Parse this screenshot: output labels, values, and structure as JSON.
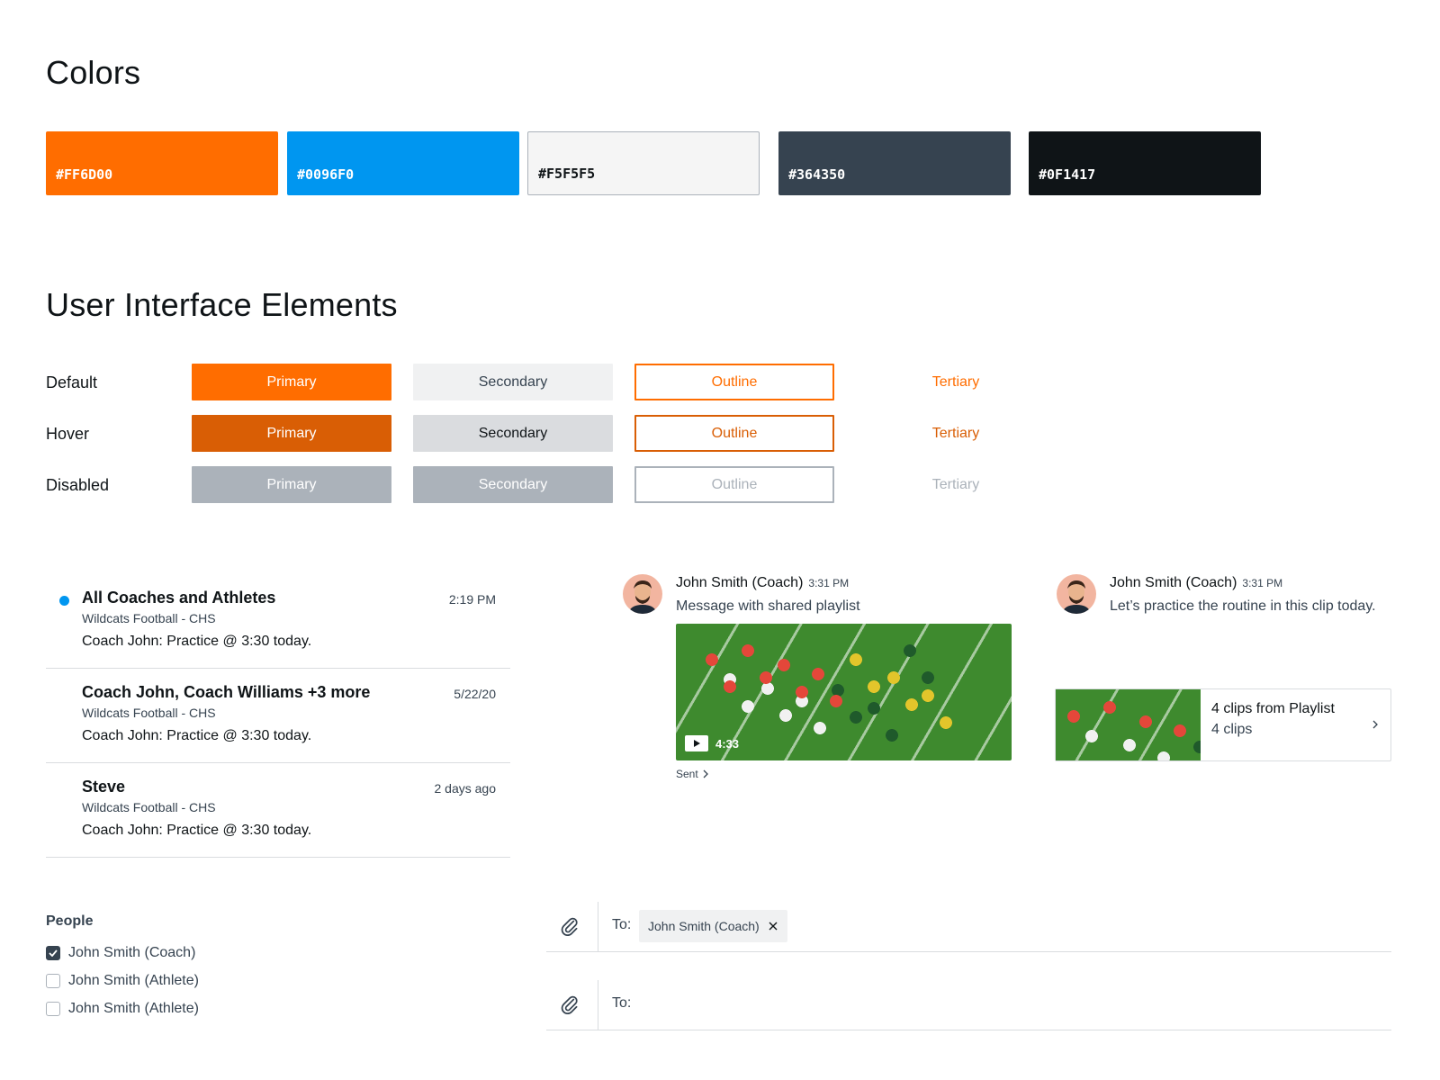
{
  "colors_section": {
    "title": "Colors",
    "swatches": [
      {
        "hex": "#FF6D00",
        "label": "#FF6D00",
        "text_color": "#FFFFFF"
      },
      {
        "hex": "#0096F0",
        "label": "#0096F0",
        "text_color": "#FFFFFF"
      },
      {
        "hex": "#F5F5F5",
        "label": "#F5F5F5",
        "text_color": "#0F1417"
      },
      {
        "hex": "#364350",
        "label": "#364350",
        "text_color": "#FFFFFF"
      },
      {
        "hex": "#0F1417",
        "label": "#0F1417",
        "text_color": "#FFFFFF"
      }
    ]
  },
  "ui_section": {
    "title": "User Interface Elements",
    "states": [
      "Default",
      "Hover",
      "Disabled"
    ],
    "buttons": {
      "primary": "Primary",
      "secondary": "Secondary",
      "outline": "Outline",
      "tertiary": "Tertiary"
    }
  },
  "threads": [
    {
      "title": "All Coaches and Athletes",
      "subtitle": "Wildcats Football - CHS",
      "message": "Coach John: Practice @ 3:30 today.",
      "time": "2:19 PM",
      "unread": true
    },
    {
      "title": "Coach John, Coach Williams +3 more",
      "subtitle": "Wildcats Football - CHS",
      "message": "Coach John: Practice @ 3:30 today.",
      "time": "5/22/20",
      "unread": false
    },
    {
      "title": "Steve",
      "subtitle": "Wildcats Football - CHS",
      "message": "Coach John: Practice @ 3:30 today.",
      "time": "2 days ago",
      "unread": false
    }
  ],
  "messages": [
    {
      "sender": "John Smith (Coach)",
      "time": "3:31 PM",
      "text": "Message with shared playlist",
      "video_duration": "4:33",
      "status": "Sent"
    },
    {
      "sender": "John Smith (Coach)",
      "time": "3:31 PM",
      "text": "Let’s practice the routine in this clip today.",
      "playlist_title": "4 clips from Playlist",
      "playlist_count": "4 clips"
    }
  ],
  "people": {
    "title": "People",
    "items": [
      {
        "name": "John Smith (Coach)",
        "checked": true
      },
      {
        "name": "John Smith (Athlete)",
        "checked": false
      },
      {
        "name": "John Smith (Athlete)",
        "checked": false
      }
    ]
  },
  "compose": {
    "to_label": "To:",
    "recipient_chip": "John Smith (Coach)"
  },
  "icons": {
    "attach": "paperclip-icon",
    "remove": "close-icon",
    "video": "play-icon",
    "chevron": "chevron-right-icon",
    "checked": "check-icon"
  },
  "accent_colors": {
    "field_green": "#3E8A2E",
    "hover_orange": "#D95E05",
    "disabled_gray": "#ABB2BA"
  }
}
